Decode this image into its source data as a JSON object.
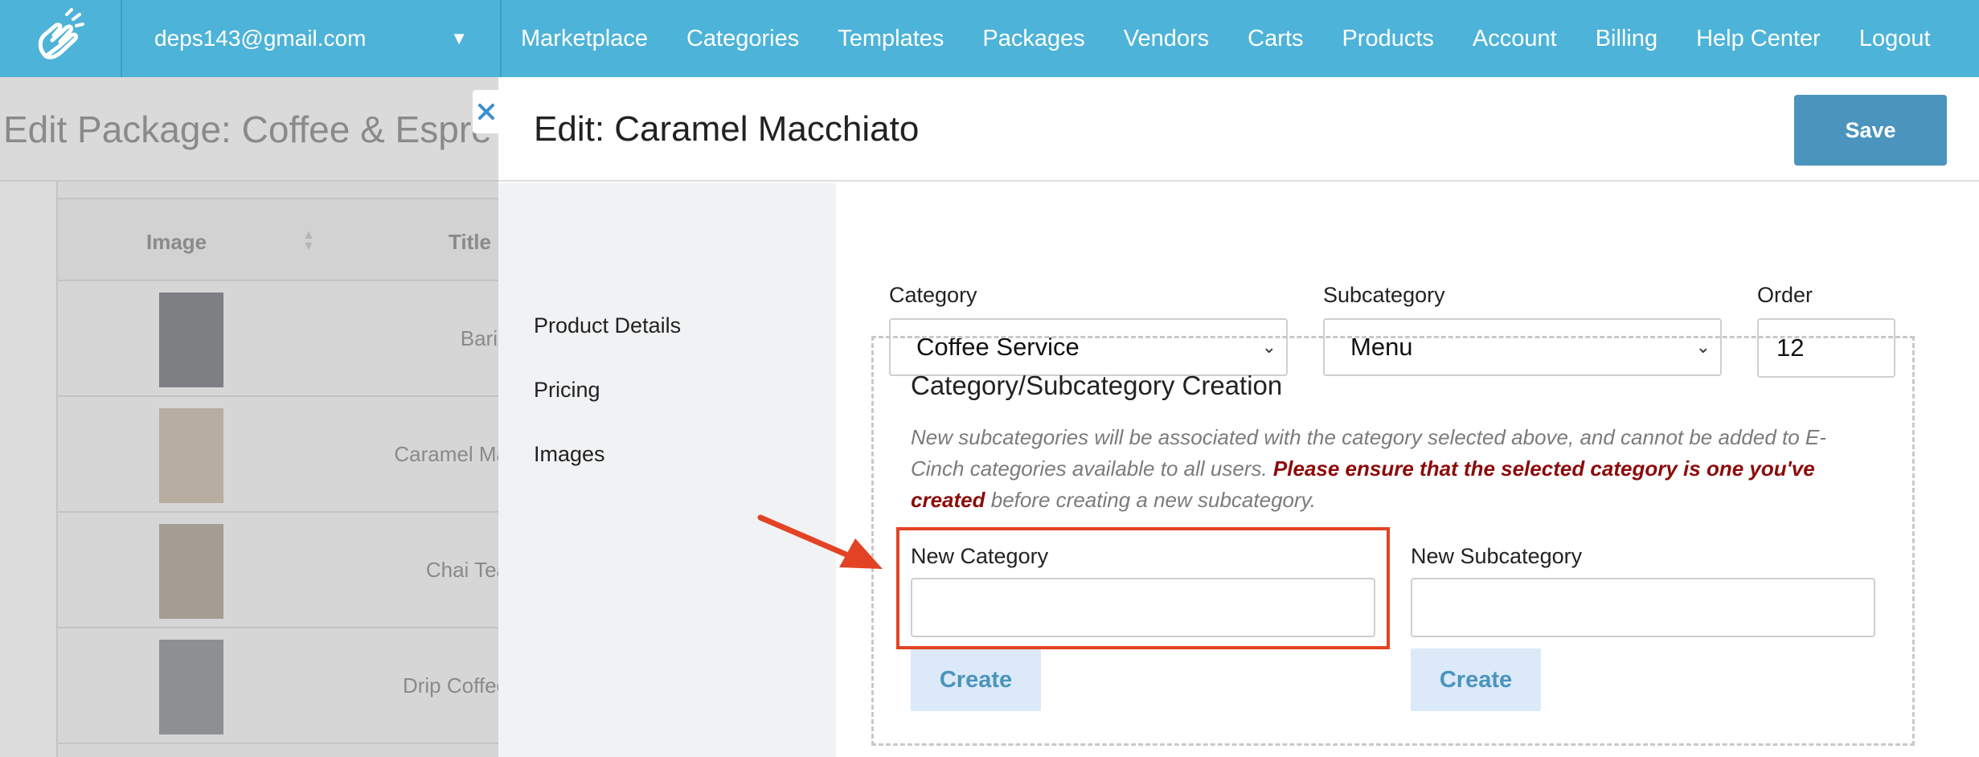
{
  "nav": {
    "account_email": "deps143@gmail.com",
    "links": [
      "Marketplace",
      "Categories",
      "Templates",
      "Packages",
      "Vendors",
      "Carts",
      "Products",
      "Account",
      "Billing",
      "Help Center",
      "Logout"
    ]
  },
  "background_page": {
    "title": "Edit Package: Coffee & Espre",
    "columns": [
      "Image",
      "Title"
    ],
    "rows": [
      {
        "title": "Baris"
      },
      {
        "title": "Caramel Ma"
      },
      {
        "title": "Chai Tea"
      },
      {
        "title": "Drip Coffee"
      }
    ]
  },
  "modal": {
    "title": "Edit: Caramel Macchiato",
    "save_label": "Save",
    "sidebar": [
      "Product Details",
      "Pricing",
      "Images"
    ],
    "category": {
      "label": "Category",
      "value": "Coffee Service"
    },
    "subcategory": {
      "label": "Subcategory",
      "value": "Menu"
    },
    "order": {
      "label": "Order",
      "value": "12"
    },
    "creation": {
      "title": "Category/Subcategory Creation",
      "note_plain": "New subcategories will be associated with the category selected above, and cannot be added to E-Cinch categories available to all users.",
      "note_warn": "Please ensure that the selected category is one you've created",
      "note_end": "before creating a new subcategory.",
      "new_category_label": "New Category",
      "new_category_value": "",
      "new_subcategory_label": "New Subcategory",
      "new_subcategory_value": "",
      "create_label": "Create"
    }
  },
  "colors": {
    "nav_bg": "#4eb3d8",
    "save_bg": "#4a94bd",
    "create_bg": "#dbe9f9",
    "warning_text": "#8b0b0b",
    "annotation_red": "#e34325"
  }
}
